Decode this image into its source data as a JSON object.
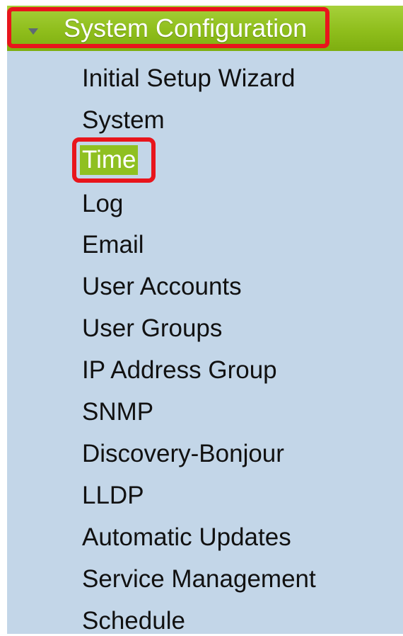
{
  "menu": {
    "header_label": "System Configuration",
    "header_icon": "caret-down-icon",
    "active_item": "Time",
    "items": [
      {
        "label": "Initial Setup Wizard"
      },
      {
        "label": "System"
      },
      {
        "label": "Time"
      },
      {
        "label": "Log"
      },
      {
        "label": "Email"
      },
      {
        "label": "User Accounts"
      },
      {
        "label": "User Groups"
      },
      {
        "label": "IP Address Group"
      },
      {
        "label": "SNMP"
      },
      {
        "label": "Discovery-Bonjour"
      },
      {
        "label": "LLDP"
      },
      {
        "label": "Automatic Updates"
      },
      {
        "label": "Service Management"
      },
      {
        "label": "Schedule"
      }
    ]
  },
  "colors": {
    "header_green": "#8fbe1c",
    "panel_background": "#c3d6e8",
    "highlight_red": "#e8151c",
    "active_item_background": "#8fc021"
  }
}
